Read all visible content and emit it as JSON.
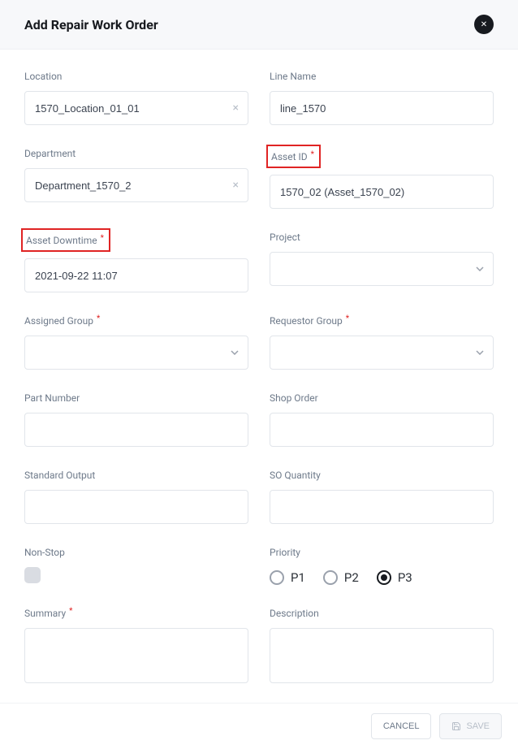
{
  "header": {
    "title": "Add Repair Work Order"
  },
  "fields": {
    "location": {
      "label": "Location",
      "value": "1570_Location_01_01"
    },
    "lineName": {
      "label": "Line Name",
      "value": "line_1570"
    },
    "department": {
      "label": "Department",
      "value": "Department_1570_2"
    },
    "assetId": {
      "label": "Asset ID",
      "value": "1570_02 (Asset_1570_02)"
    },
    "assetDowntime": {
      "label": "Asset Downtime",
      "value": "2021-09-22 11:07"
    },
    "project": {
      "label": "Project",
      "value": ""
    },
    "assignedGroup": {
      "label": "Assigned Group",
      "value": ""
    },
    "requestorGroup": {
      "label": "Requestor Group",
      "value": ""
    },
    "partNumber": {
      "label": "Part Number",
      "value": ""
    },
    "shopOrder": {
      "label": "Shop Order",
      "value": ""
    },
    "standardOutput": {
      "label": "Standard Output",
      "value": ""
    },
    "soQuantity": {
      "label": "SO Quantity",
      "value": ""
    },
    "nonStop": {
      "label": "Non-Stop"
    },
    "priority": {
      "label": "Priority",
      "options": [
        "P1",
        "P2",
        "P3"
      ],
      "selected": "P3"
    },
    "summary": {
      "label": "Summary",
      "value": ""
    },
    "description": {
      "label": "Description",
      "value": ""
    }
  },
  "footer": {
    "cancel": "CANCEL",
    "save": "SAVE"
  }
}
